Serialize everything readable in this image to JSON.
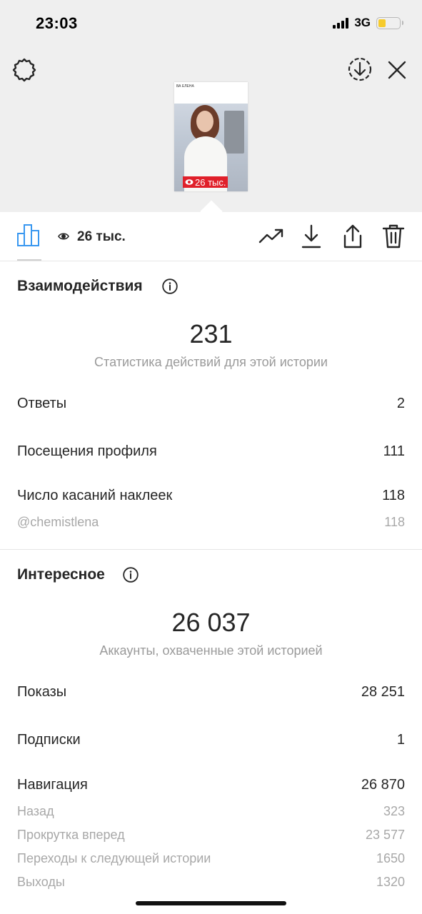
{
  "status_bar": {
    "time": "23:03",
    "network": "3G"
  },
  "story": {
    "thumbnail_header": "ВА ЕЛЕНА",
    "thumbnail_views": "26 тыс.",
    "views": "26 тыс."
  },
  "toolbar": {
    "icons": [
      "bar-chart-icon",
      "eye-icon",
      "trending-up-icon",
      "download-icon",
      "share-icon",
      "trash-icon"
    ]
  },
  "interactions": {
    "title": "Взаимодействия",
    "total": "231",
    "caption": "Статистика действий для этой истории",
    "rows": [
      {
        "label": "Ответы",
        "value": "2"
      },
      {
        "label": "Посещения профиля",
        "value": "111"
      },
      {
        "label": "Число касаний наклеек",
        "value": "118"
      }
    ],
    "sub_rows": [
      {
        "label": "@chemistlena",
        "value": "118"
      }
    ]
  },
  "discovery": {
    "title": "Интересное",
    "total": "26 037",
    "caption": "Аккаунты, охваченные этой историей",
    "rows": [
      {
        "label": "Показы",
        "value": "28 251"
      },
      {
        "label": "Подписки",
        "value": "1"
      },
      {
        "label": "Навигация",
        "value": "26 870"
      }
    ],
    "sub_rows": [
      {
        "label": "Назад",
        "value": "323"
      },
      {
        "label": "Прокрутка вперед",
        "value": "23 577"
      },
      {
        "label": "Переходы к следующей истории",
        "value": "1650"
      },
      {
        "label": "Выходы",
        "value": "1320"
      }
    ]
  },
  "colors": {
    "accent_blue": "#3897f0",
    "text_primary": "#262626",
    "text_secondary": "#9a9a9a",
    "top_background": "#efefef",
    "battery": "#f6cb2c"
  }
}
